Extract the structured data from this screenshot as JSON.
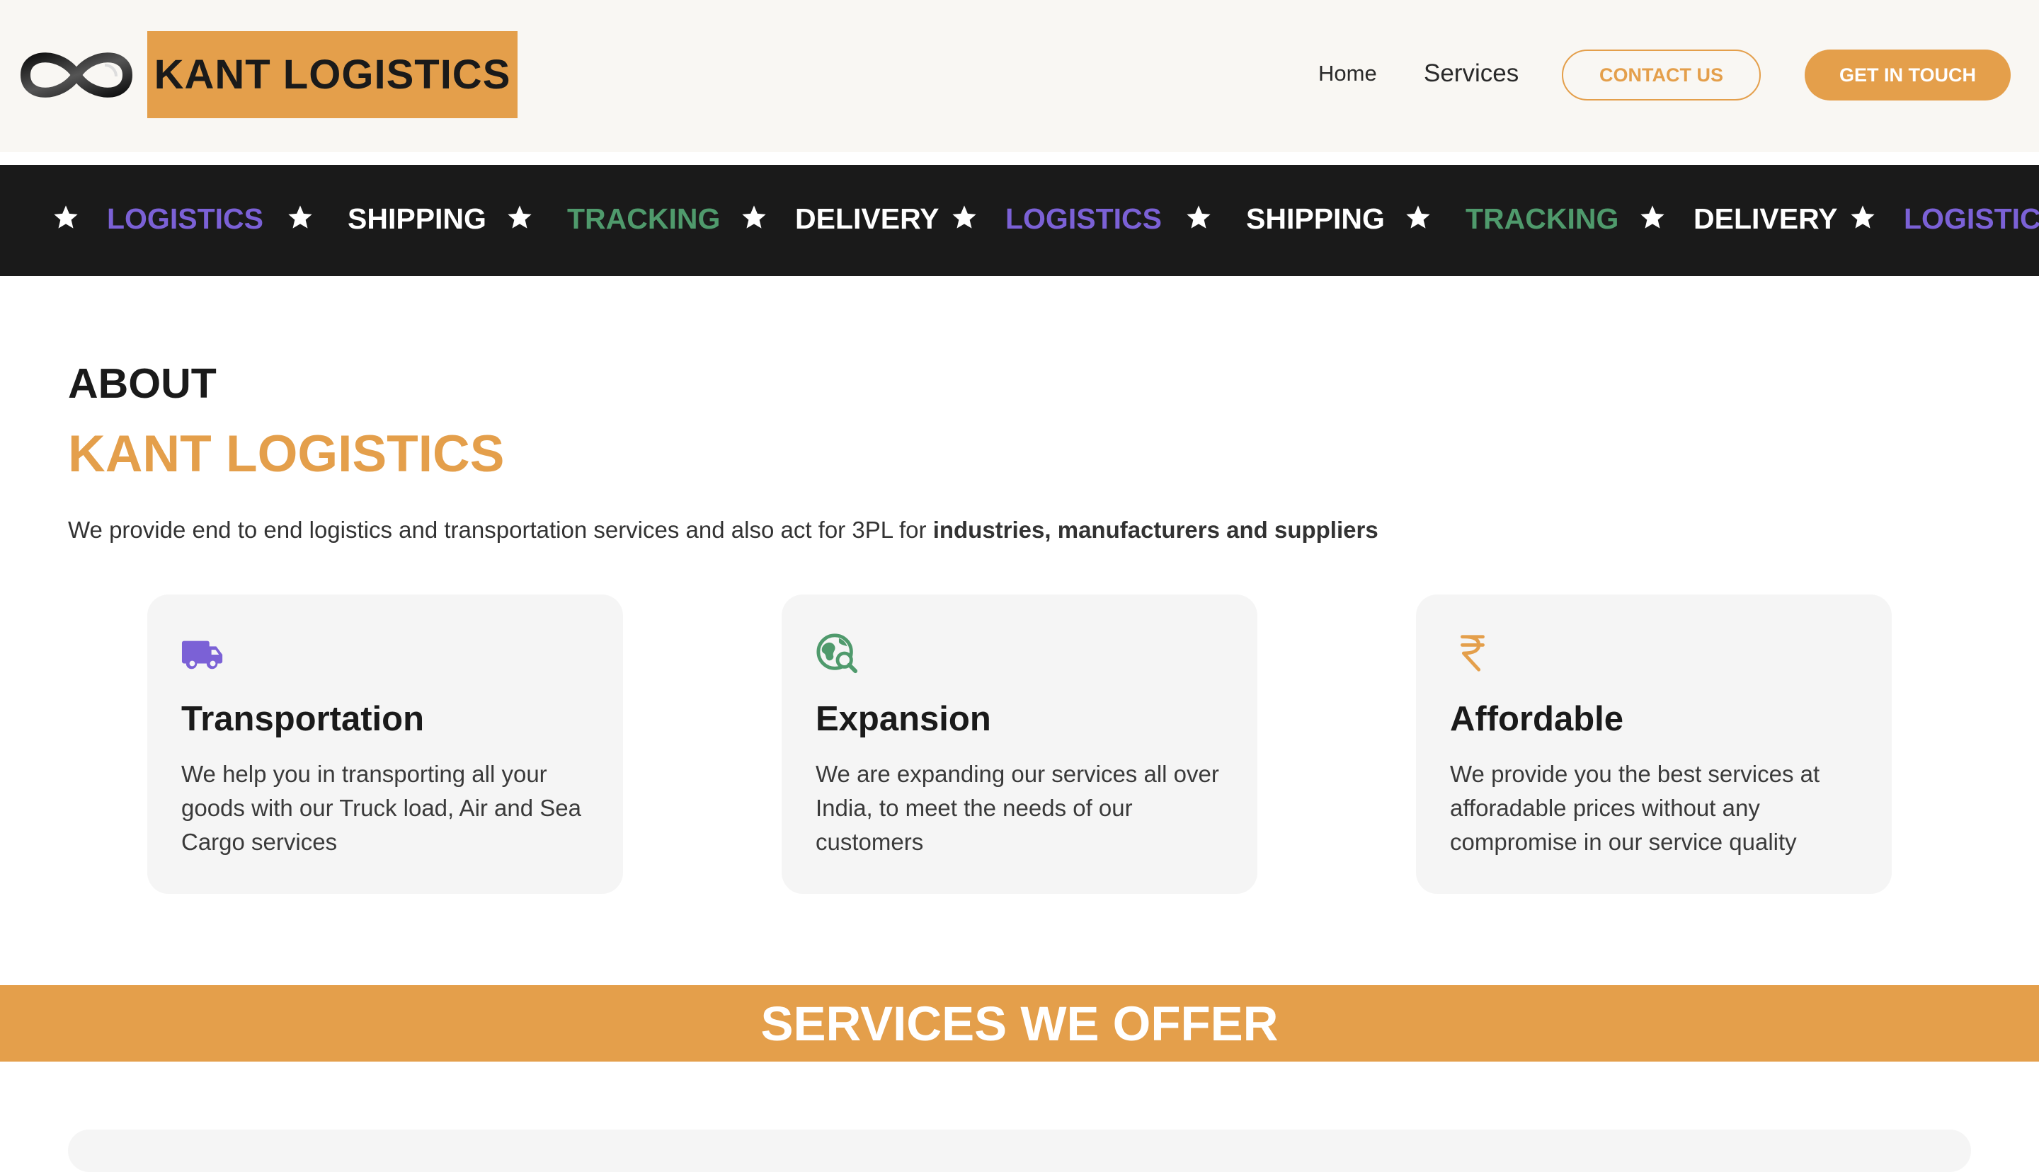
{
  "brand": {
    "logo_text": "KANT LOGISTICS",
    "logo_icon": "infinity-icon",
    "accent_color": "#e49f4b"
  },
  "nav": {
    "home": "Home",
    "services": "Services",
    "contact_button": "CONTACT US",
    "touch_button": "GET IN TOUCH"
  },
  "marquee": {
    "star_icon": "star-icon",
    "items": [
      {
        "label": "LOGISTICS",
        "color": "#7b61d6"
      },
      {
        "label": "SHIPPING",
        "color": "#ffffff"
      },
      {
        "label": "TRACKING",
        "color": "#4f9a6c"
      },
      {
        "label": "DELIVERY",
        "color": "#ffffff"
      },
      {
        "label": "LOGISTICS",
        "color": "#7b61d6"
      },
      {
        "label": "SHIPPING",
        "color": "#ffffff"
      },
      {
        "label": "TRACKING",
        "color": "#4f9a6c"
      },
      {
        "label": "DELIVERY",
        "color": "#ffffff"
      },
      {
        "label": "LOGISTICS",
        "color": "#7b61d6"
      }
    ]
  },
  "about": {
    "title": "ABOUT",
    "subtitle": "KANT LOGISTICS",
    "description_plain": "We provide end to end logistics and transportation services and also act for 3PL for ",
    "description_bold": "industries, manufacturers and suppliers"
  },
  "cards": [
    {
      "icon": "truck-icon",
      "icon_color": "#7b61d6",
      "title": "Transportation",
      "text": "We help you in transporting all your goods with our Truck load, Air and Sea Cargo services"
    },
    {
      "icon": "globe-search-icon",
      "icon_color": "#4f9a6c",
      "title": "Expansion",
      "text": "We are expanding our services all over India, to meet the needs of our customers"
    },
    {
      "icon": "rupee-icon",
      "icon_color": "#e49f4b",
      "title": "Affordable",
      "text": "We provide you the best services at afforadable prices without any compromise in our service quality"
    }
  ],
  "services": {
    "title": "SERVICES WE OFFER"
  }
}
